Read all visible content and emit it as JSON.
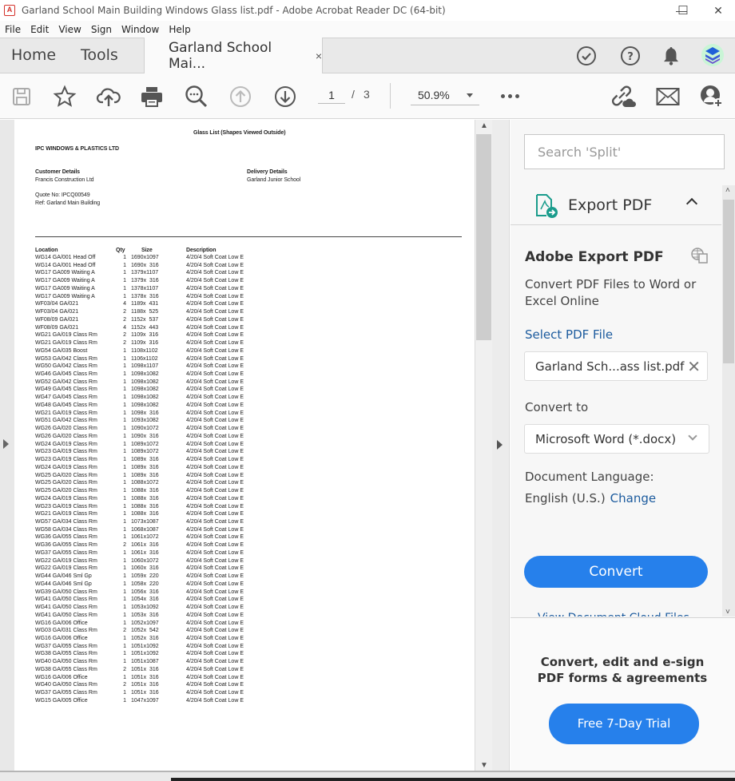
{
  "window": {
    "title": "Garland School Main Building Windows Glass list.pdf - Adobe Acrobat Reader DC (64-bit)",
    "minimize": "—",
    "maximize": "☐",
    "close": "✕"
  },
  "menu": [
    "File",
    "Edit",
    "View",
    "Sign",
    "Window",
    "Help"
  ],
  "tabs": {
    "home": "Home",
    "tools": "Tools",
    "document": "Garland School Mai...",
    "close": "×"
  },
  "header_icons": [
    "check-circle-icon",
    "help-icon",
    "bell-icon",
    "avatar-icon"
  ],
  "toolbar": {
    "icons": [
      "save-icon",
      "star-icon",
      "cloud-upload-icon",
      "print-icon",
      "zoom-search-icon",
      "page-up-icon",
      "page-down-icon"
    ],
    "page_current": "1",
    "page_sep": "/",
    "page_total": "3",
    "zoom": "50.9%",
    "right_icons": [
      "share-link-icon",
      "email-icon",
      "add-user-icon"
    ]
  },
  "pdf": {
    "title": "Glass List (Shapes Viewed Outside)",
    "company": "IPC WINDOWS & PLASTICS LTD",
    "customer_heading": "Customer Details",
    "customer_name": "Francis Construction Ltd",
    "delivery_heading": "Delivery Details",
    "delivery_name": "Garland Junior School",
    "quote": "Quote No: IPCQ00549",
    "ref": "Ref: Garland Main Building",
    "columns": {
      "location": "Location",
      "qty": "Qty",
      "size": "Size",
      "description": "Description"
    },
    "rows": [
      [
        "WG14 GA/001 Head Off",
        "1",
        "1690x1097",
        "4/20/4 Soft Coat Low E"
      ],
      [
        "WG14 GA/001 Head Off",
        "1",
        "1690x  316",
        "4/20/4 Soft Coat Low E"
      ],
      [
        "WG17 GA009 Waiting A",
        "1",
        "1379x1107",
        "4/20/4 Soft Coat Low E"
      ],
      [
        "WG17 GA009 Waiting A",
        "1",
        "1379x  316",
        "4/20/4 Soft Coat Low E"
      ],
      [
        "WG17 GA009 Waiting A",
        "1",
        "1378x1107",
        "4/20/4 Soft Coat Low E"
      ],
      [
        "WG17 GA009 Waiting A",
        "1",
        "1378x  316",
        "4/20/4 Soft Coat Low E"
      ],
      [
        "WF03/04 GA/021",
        "4",
        "1189x  431",
        "4/20/4 Soft Coat Low E"
      ],
      [
        "WF03/04 GA/021",
        "2",
        "1188x  525",
        "4/20/4 Soft Coat Low E"
      ],
      [
        "WF08/09 GA/021",
        "2",
        "1152x  537",
        "4/20/4 Soft Coat Low E"
      ],
      [
        "WF08/09 GA/021",
        "4",
        "1152x  443",
        "4/20/4 Soft Coat Low E"
      ],
      [
        "WG21 GA/019 Class Rm",
        "2",
        "1109x  316",
        "4/20/4 Soft Coat Low E"
      ],
      [
        "WG21 GA/019 Class Rm",
        "2",
        "1109x  316",
        "4/20/4 Soft Coat Low E"
      ],
      [
        "WG54 GA/035 Boost",
        "1",
        "1108x1102",
        "4/20/4 Soft Coat Low E"
      ],
      [
        "WG53 GA/042 Class Rm",
        "1",
        "1106x1102",
        "4/20/4 Soft Coat Low E"
      ],
      [
        "WG50 GA/042 Class Rm",
        "1",
        "1098x1107",
        "4/20/4 Soft Coat Low E"
      ],
      [
        "WG46 GA/045 Class Rm",
        "1",
        "1098x1082",
        "4/20/4 Soft Coat Low E"
      ],
      [
        "WG52 GA/042 Class Rm",
        "1",
        "1098x1082",
        "4/20/4 Soft Coat Low E"
      ],
      [
        "WG49 GA/045 Class Rm",
        "1",
        "1098x1082",
        "4/20/4 Soft Coat Low E"
      ],
      [
        "WG47 GA/045 Class Rm",
        "1",
        "1098x1082",
        "4/20/4 Soft Coat Low E"
      ],
      [
        "WG48 GA/045 Class Rm",
        "1",
        "1098x1082",
        "4/20/4 Soft Coat Low E"
      ],
      [
        "WG21 GA/019 Class Rm",
        "1",
        "1098x  316",
        "4/20/4 Soft Coat Low E"
      ],
      [
        "WG51 GA/042 Class Rm",
        "1",
        "1093x1082",
        "4/20/4 Soft Coat Low E"
      ],
      [
        "WG26 GA/020 Class Rm",
        "1",
        "1090x1072",
        "4/20/4 Soft Coat Low E"
      ],
      [
        "WG26 GA/020 Class Rm",
        "1",
        "1090x  316",
        "4/20/4 Soft Coat Low E"
      ],
      [
        "WG24 GA/019 Class Rm",
        "1",
        "1089x1072",
        "4/20/4 Soft Coat Low E"
      ],
      [
        "WG23 GA/019 Class Rm",
        "1",
        "1089x1072",
        "4/20/4 Soft Coat Low E"
      ],
      [
        "WG23 GA/019 Class Rm",
        "1",
        "1089x  316",
        "4/20/4 Soft Coat Low E"
      ],
      [
        "WG24 GA/019 Class Rm",
        "1",
        "1089x  316",
        "4/20/4 Soft Coat Low E"
      ],
      [
        "WG25 GA/020 Class Rm",
        "1",
        "1089x  316",
        "4/20/4 Soft Coat Low E"
      ],
      [
        "WG25 GA/020 Class Rm",
        "1",
        "1088x1072",
        "4/20/4 Soft Coat Low E"
      ],
      [
        "WG25 GA/020 Class Rm",
        "1",
        "1088x  316",
        "4/20/4 Soft Coat Low E"
      ],
      [
        "WG24 GA/019 Class Rm",
        "1",
        "1088x  316",
        "4/20/4 Soft Coat Low E"
      ],
      [
        "WG23 GA/019 Class Rm",
        "1",
        "1088x  316",
        "4/20/4 Soft Coat Low E"
      ],
      [
        "WG21 GA/019 Class Rm",
        "1",
        "1088x  316",
        "4/20/4 Soft Coat Low E"
      ],
      [
        "WG57 GA/034 Class Rm",
        "1",
        "1073x1087",
        "4/20/4 Soft Coat Low E"
      ],
      [
        "WG58 GA/034 Class Rm",
        "1",
        "1068x1087",
        "4/20/4 Soft Coat Low E"
      ],
      [
        "WG36 GA/055 Class Rm",
        "1",
        "1061x1072",
        "4/20/4 Soft Coat Low E"
      ],
      [
        "WG36 GA/055 Class Rm",
        "2",
        "1061x  316",
        "4/20/4 Soft Coat Low E"
      ],
      [
        "WG37 GA/055 Class Rm",
        "1",
        "1061x  316",
        "4/20/4 Soft Coat Low E"
      ],
      [
        "WG22 GA/019 Class Rm",
        "1",
        "1060x1072",
        "4/20/4 Soft Coat Low E"
      ],
      [
        "WG22 GA/019 Class Rm",
        "1",
        "1060x  316",
        "4/20/4 Soft Coat Low E"
      ],
      [
        "WG44 GA/046 Sml Gp",
        "1",
        "1059x  220",
        "4/20/4 Soft Coat Low E"
      ],
      [
        "WG44 GA/046 Sml Gp",
        "1",
        "1058x  220",
        "4/20/4 Soft Coat Low E"
      ],
      [
        "WG39 GA/050 Class Rm",
        "1",
        "1056x  316",
        "4/20/4 Soft Coat Low E"
      ],
      [
        "WG41 GA/050 Class Rm",
        "1",
        "1054x  316",
        "4/20/4 Soft Coat Low E"
      ],
      [
        "WG41 GA/050 Class Rm",
        "1",
        "1053x1092",
        "4/20/4 Soft Coat Low E"
      ],
      [
        "WG41 GA/050 Class Rm",
        "1",
        "1053x  316",
        "4/20/4 Soft Coat Low E"
      ],
      [
        "WG16 GA/006 Office",
        "1",
        "1052x1097",
        "4/20/4 Soft Coat Low E"
      ],
      [
        "WG03 GA/031 Class Rm",
        "2",
        "1052x  542",
        "4/20/4 Soft Coat Low E"
      ],
      [
        "WG16 GA/006 Office",
        "1",
        "1052x  316",
        "4/20/4 Soft Coat Low E"
      ],
      [
        "WG37 GA/055 Class Rm",
        "1",
        "1051x1092",
        "4/20/4 Soft Coat Low E"
      ],
      [
        "WG38 GA/055 Class Rm",
        "1",
        "1051x1092",
        "4/20/4 Soft Coat Low E"
      ],
      [
        "WG40 GA/050 Class Rm",
        "1",
        "1051x1087",
        "4/20/4 Soft Coat Low E"
      ],
      [
        "WG38 GA/055 Class Rm",
        "2",
        "1051x  316",
        "4/20/4 Soft Coat Low E"
      ],
      [
        "WG16 GA/006 Office",
        "1",
        "1051x  316",
        "4/20/4 Soft Coat Low E"
      ],
      [
        "WG40 GA/050 Class Rm",
        "2",
        "1051x  316",
        "4/20/4 Soft Coat Low E"
      ],
      [
        "WG37 GA/055 Class Rm",
        "1",
        "1051x  316",
        "4/20/4 Soft Coat Low E"
      ],
      [
        "WG15 GA/005 Office",
        "1",
        "1047x1097",
        "4/20/4 Soft Coat Low E"
      ]
    ]
  },
  "panel": {
    "search_placeholder": "Search 'Split'",
    "section_title": "Export PDF",
    "heading": "Adobe Export PDF",
    "description": "Convert PDF Files to Word or Excel Online",
    "select_file_label": "Select PDF File",
    "selected_file": "Garland Sch...ass list.pdf",
    "clear_file": "✕",
    "convert_to_label": "Convert to",
    "convert_to_value": "Microsoft Word (*.docx)",
    "language_label": "Document Language:",
    "language_value": "English (U.S.)",
    "language_change": "Change",
    "convert_button": "Convert",
    "cloud_link": "View Document Cloud Files",
    "promo_text": "Convert, edit and e-sign PDF forms & agreements",
    "trial_button": "Free 7-Day Trial"
  },
  "colors": {
    "accent": "#2680eb",
    "link": "#1c5b9e",
    "export_icon": "#1a9c8c",
    "app_icon": "#d4312a"
  }
}
